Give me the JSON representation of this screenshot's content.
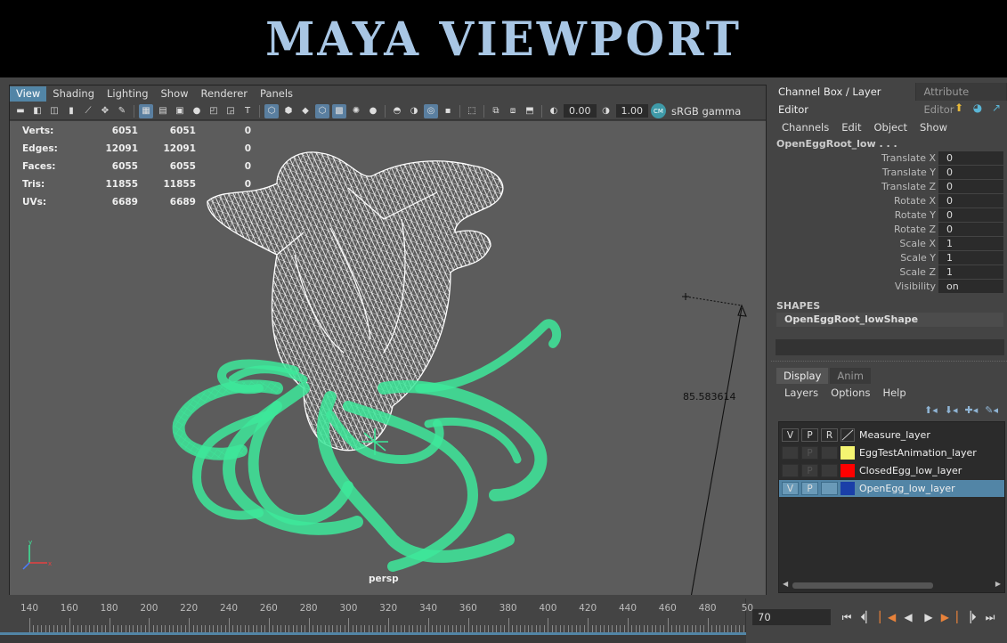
{
  "banner": {
    "title": "MAYA VIEWPORT"
  },
  "viewport": {
    "menu": [
      {
        "label": "View",
        "active": true
      },
      {
        "label": "Shading"
      },
      {
        "label": "Lighting"
      },
      {
        "label": "Show"
      },
      {
        "label": "Renderer"
      },
      {
        "label": "Panels"
      }
    ],
    "toolbar": {
      "value1": "0.00",
      "value2": "1.00",
      "color_space": "sRGB gamma"
    },
    "hud": [
      {
        "label": "Verts:",
        "a": "6051",
        "b": "6051",
        "c": "0"
      },
      {
        "label": "Edges:",
        "a": "12091",
        "b": "12091",
        "c": "0"
      },
      {
        "label": "Faces:",
        "a": "6055",
        "b": "6055",
        "c": "0"
      },
      {
        "label": "Tris:",
        "a": "11855",
        "b": "11855",
        "c": "0"
      },
      {
        "label": "UVs:",
        "a": "6689",
        "b": "6689",
        "c": ""
      }
    ],
    "camera": "persp",
    "measure": "85.583614",
    "colors": {
      "wire_white": "#ffffff",
      "wire_green": "#3de89a",
      "background": "#5c5c5c"
    }
  },
  "right_panel": {
    "tabs": [
      "Channel Box / Layer Editor",
      "Attribute Editor"
    ],
    "menu": [
      "Channels",
      "Edit",
      "Object",
      "Show"
    ],
    "object": "OpenEggRoot_low . . .",
    "attributes": [
      {
        "name": "Translate X",
        "value": "0"
      },
      {
        "name": "Translate Y",
        "value": "0"
      },
      {
        "name": "Translate Z",
        "value": "0"
      },
      {
        "name": "Rotate X",
        "value": "0"
      },
      {
        "name": "Rotate Y",
        "value": "0"
      },
      {
        "name": "Rotate Z",
        "value": "0"
      },
      {
        "name": "Scale X",
        "value": "1"
      },
      {
        "name": "Scale Y",
        "value": "1"
      },
      {
        "name": "Scale Z",
        "value": "1"
      },
      {
        "name": "Visibility",
        "value": "on"
      }
    ],
    "shapes_header": "SHAPES",
    "shape": "OpenEggRoot_lowShape",
    "layer_tabs": [
      "Display",
      "Anim"
    ],
    "layer_menu": [
      "Layers",
      "Options",
      "Help"
    ],
    "layers": [
      {
        "v": "V",
        "p": "P",
        "r": "R",
        "name": "Measure_layer",
        "color": "none"
      },
      {
        "v": "",
        "p": "P",
        "r": "",
        "name": "EggTestAnimation_layer",
        "color": "#f5f571"
      },
      {
        "v": "",
        "p": "P",
        "r": "",
        "name": "ClosedEgg_low_layer",
        "color": "#ff0000"
      },
      {
        "v": "V",
        "p": "P",
        "r": "",
        "name": "OpenEgg_low_layer",
        "color": "#1a3fa8",
        "selected": true
      }
    ]
  },
  "timeline": {
    "ticks": [
      "140",
      "160",
      "180",
      "200",
      "220",
      "240",
      "260",
      "280",
      "300",
      "320",
      "340",
      "360",
      "380",
      "400",
      "420",
      "440",
      "460",
      "480",
      "50"
    ],
    "current_frame": "70"
  }
}
